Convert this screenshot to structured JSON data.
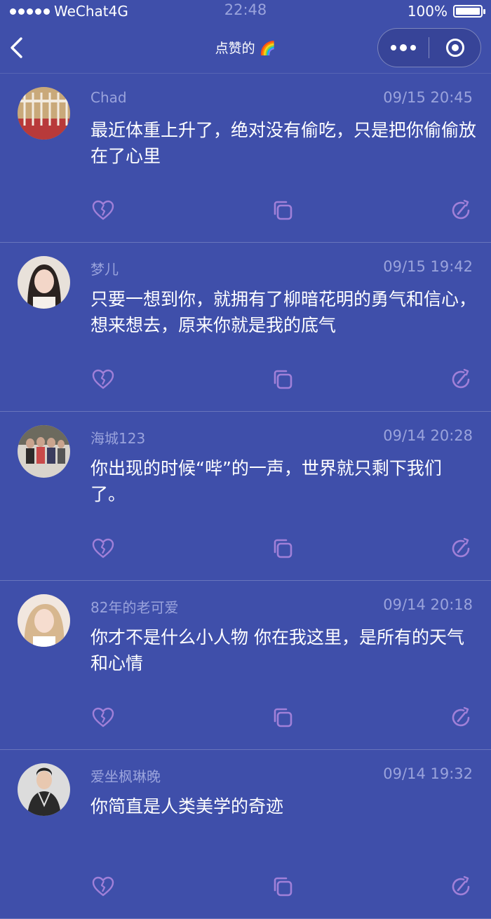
{
  "status_bar": {
    "carrier": "WeChat4G",
    "time": "22:48",
    "battery": "100%",
    "battery_level": 1.0
  },
  "nav": {
    "title": "点赞的 🌈",
    "back_icon": "chevron-left-icon",
    "more_icon": "more-dots-icon",
    "close_icon": "target-close-icon"
  },
  "colors": {
    "background": "#3f4faa",
    "meta_text": "#9aa3dc",
    "action_icon": "#a080d8"
  },
  "posts": [
    {
      "name": "Chad",
      "time": "09/15 20:45",
      "content": "最近体重上升了，绝对没有偷吃，只是把你偷偷放在了心里"
    },
    {
      "name": "梦儿",
      "time": "09/15 19:42",
      "content": "只要一想到你，就拥有了柳暗花明的勇气和信心，想来想去，原来你就是我的底气"
    },
    {
      "name": "海城123",
      "time": "09/14 20:28",
      "content": "你出现的时候“哔”的一声，世界就只剩下我们了。"
    },
    {
      "name": "82年的老可爱",
      "time": "09/14 20:18",
      "content": "你才不是什么小人物 你在我这里，是所有的天气和心情"
    },
    {
      "name": "爱坐枫琳晚",
      "time": "09/14 19:32",
      "content": "你简直是人类美学的奇迹"
    }
  ]
}
